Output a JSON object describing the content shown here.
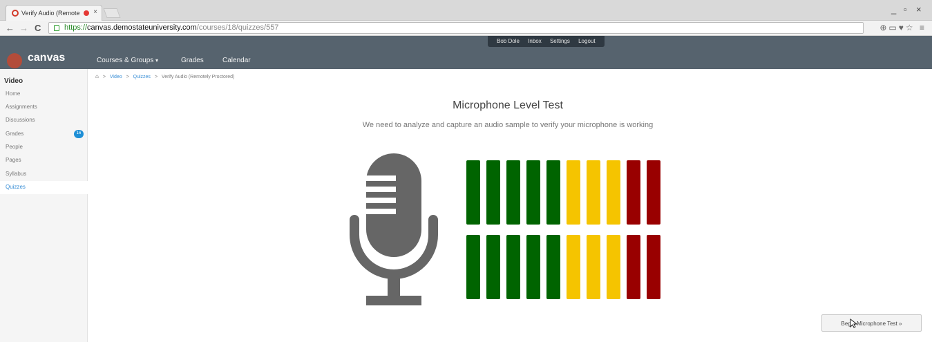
{
  "browser": {
    "tab_title": "Verify Audio (Remote",
    "tab_close": "×",
    "nav_back": "←",
    "nav_forward": "→",
    "nav_reload": "C",
    "url_scheme": "https://",
    "url_host": "canvas.demostateuniversity.com",
    "url_path": "/courses/18/quizzes/557",
    "ext_icons": "⊕▭♥☆ ≡",
    "minimize": "_",
    "maximize": "▫",
    "close": "×"
  },
  "header": {
    "logo": "canvas",
    "nav": [
      "Courses & Groups",
      "Grades",
      "Calendar"
    ],
    "dropdown_caret": "▾",
    "user_menu": [
      "Bob Dole",
      "Inbox",
      "Settings",
      "Logout"
    ],
    "brand_color": "#56636e"
  },
  "sidebar": {
    "course": "Video",
    "items": [
      {
        "label": "Home"
      },
      {
        "label": "Assignments"
      },
      {
        "label": "Discussions"
      },
      {
        "label": "Grades",
        "badge": "16"
      },
      {
        "label": "People"
      },
      {
        "label": "Pages"
      },
      {
        "label": "Syllabus"
      },
      {
        "label": "Quizzes",
        "active": true
      }
    ]
  },
  "breadcrumb": {
    "home_icon": "⌂",
    "separator": ">",
    "items": [
      "Video",
      "Quizzes",
      "Verify Audio (Remotely Proctored)"
    ]
  },
  "main": {
    "title": "Microphone Level Test",
    "subtitle": "We need to analyze and capture an audio sample to verify your microphone is working",
    "begin_button": "Begin Microphone Test »"
  },
  "level_meter": {
    "rows": 2,
    "bar_colors": [
      "#006400",
      "#006400",
      "#006400",
      "#006400",
      "#006400",
      "#f5c400",
      "#f5c400",
      "#f5c400",
      "#990000",
      "#990000"
    ],
    "mic_color": "#666666"
  }
}
